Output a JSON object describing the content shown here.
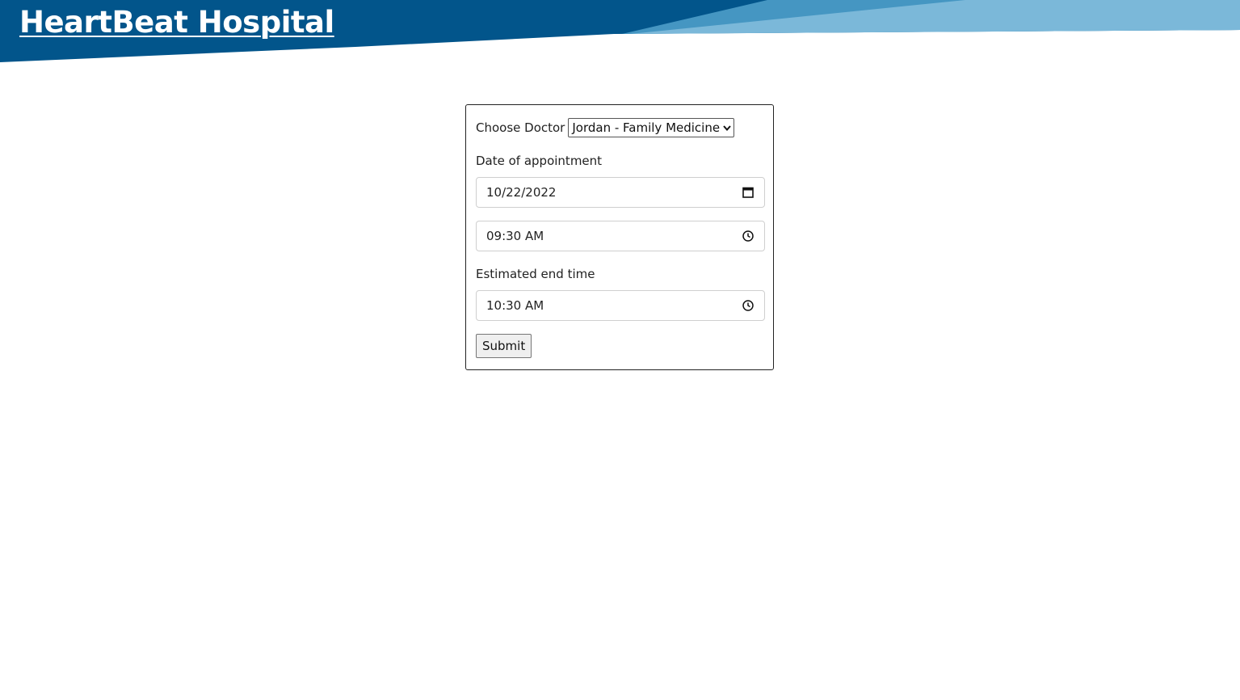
{
  "header": {
    "title": "HeartBeat Hospital",
    "colors": {
      "dark_blue": "#02558b",
      "mid_blue": "#4596c2",
      "light_blue": "#7bb8d9"
    }
  },
  "form": {
    "doctor_label": "Choose Doctor",
    "doctor_selected": "Jordan - Family Medicine",
    "date_label": "Date of appointment",
    "date_value": "10/22/2022",
    "start_time_value": "09:30  AM",
    "end_label": "Estimated end time",
    "end_time_value": "10:30  AM",
    "submit_label": "Submit"
  },
  "icons": {
    "select": "chevron-down-icon",
    "date": "calendar-icon",
    "time": "clock-icon"
  }
}
